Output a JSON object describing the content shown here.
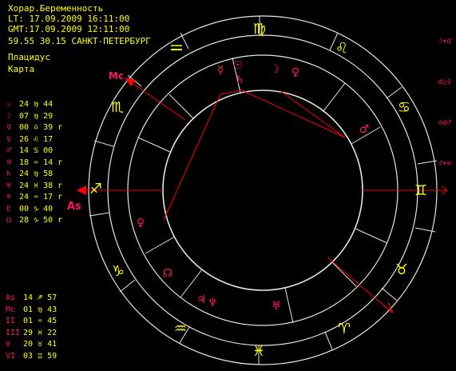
{
  "header": {
    "title": "Хорар.Беременность",
    "lt": "LT: 17.09.2009 16:11:00",
    "gmt": "GMT:17.09.2009 12:11:00",
    "location": "59.55 30.15 САНКТ-ПЕТЕРБУРГ",
    "house_system": "Плацидус",
    "mode": "Карта"
  },
  "aspects": [
    "☽✶☌",
    "☌△♀",
    "⊙☌♂",
    "♂✶⊙"
  ],
  "planets": [
    {
      "glyph": "☉",
      "value": "24 ♍ 44"
    },
    {
      "glyph": "☽",
      "value": "07 ♍ 29"
    },
    {
      "glyph": "☿",
      "value": "00 ♎ 39 r"
    },
    {
      "glyph": "♀",
      "value": "26 ♌ 17"
    },
    {
      "glyph": "♂",
      "value": "14 ♋ 00"
    },
    {
      "glyph": "♃",
      "value": "18 ♒ 14 r"
    },
    {
      "glyph": "♄",
      "value": "24 ♍ 58"
    },
    {
      "glyph": "♅",
      "value": "24 ♓ 38 r"
    },
    {
      "glyph": "♆",
      "value": "24 ♒ 17 r"
    },
    {
      "glyph": "♇",
      "value": "00 ♑ 40"
    },
    {
      "glyph": "☊",
      "value": "28 ♑ 50 r"
    }
  ],
  "houses": [
    {
      "label": "As",
      "value": "14 ♐ 57"
    },
    {
      "label": "Mc",
      "value": "01 ♍ 43"
    },
    {
      "label": "II",
      "value": "01 ♒ 45"
    },
    {
      "label": "III",
      "value": "29 ♓ 22"
    },
    {
      "label": "V",
      "value": "20 ♉ 41"
    },
    {
      "label": "VI",
      "value": "03 ♊ 59"
    }
  ],
  "wheel": {
    "asc_label": "As",
    "mc_label": "Mc",
    "signs": [
      "♍",
      "♌",
      "♋",
      "♊",
      "♉",
      "♈",
      "♓",
      "♒",
      "♑",
      "♐",
      "♏"
    ],
    "planet_glyphs": [
      "☿",
      "☉",
      "♄",
      "☽",
      "♀",
      "♂",
      "♀",
      "☊",
      "♃",
      "♆",
      "♅"
    ]
  },
  "colors": {
    "text": "#ffff00",
    "glyph": "#ff1464",
    "line": "#ff0000",
    "wheel": "#e6e6e6",
    "background": "#000000"
  }
}
